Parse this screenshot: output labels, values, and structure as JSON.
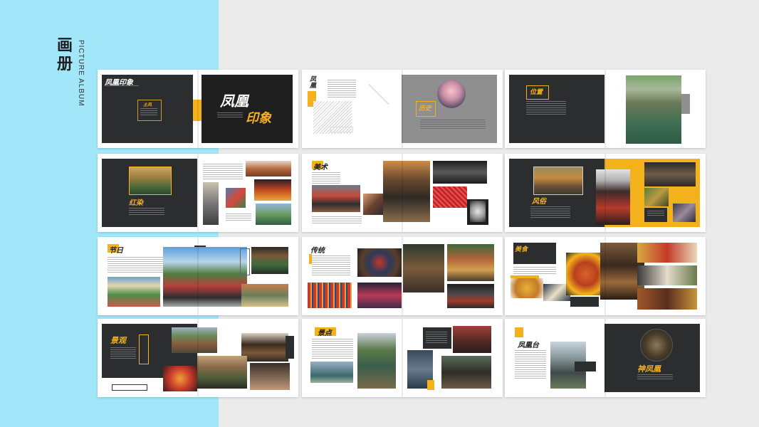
{
  "page": {
    "title": "画册",
    "subtitle": "PICTURE ALBUM"
  },
  "spreads": [
    {
      "headings": [
        "凤凰印象",
        "凤凰",
        "印象",
        "土风"
      ]
    },
    {
      "headings": [
        "凤凰",
        "历史"
      ]
    },
    {
      "headings": [
        "位置"
      ]
    },
    {
      "headings": [
        "红染"
      ]
    },
    {
      "headings": [
        "美术"
      ]
    },
    {
      "headings": [
        "风俗"
      ]
    },
    {
      "headings": [
        "节日"
      ]
    },
    {
      "headings": [
        "传统"
      ]
    },
    {
      "headings": [
        "美食"
      ]
    },
    {
      "headings": [
        "景观"
      ]
    },
    {
      "headings": [
        "景点"
      ]
    },
    {
      "headings": [
        "凤凰台",
        "神凤凰"
      ]
    }
  ],
  "colors": {
    "accent": "#f3b21b",
    "dark_panel": "#2b2d2f",
    "left_band": "#a2e6f9",
    "background": "#ebebeb"
  }
}
